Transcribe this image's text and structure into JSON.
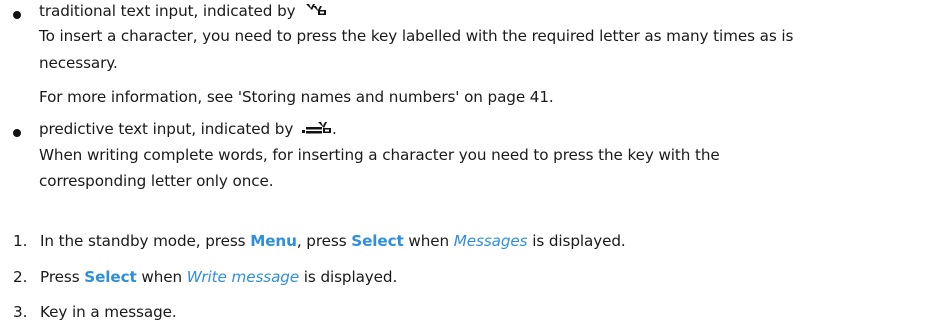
{
  "bullets": [
    {
      "lead": "traditional text input, indicated by",
      "icon": "traditional-input-icon",
      "lines": [
        "To insert a character, you need to press the key labelled with the required letter as many times as is",
        "necessary.",
        "For more information, see 'Storing names and numbers' on page 41."
      ]
    },
    {
      "lead": "predictive text input, indicated by",
      "icon": "predictive-input-icon",
      "lead_end": ".",
      "lines": [
        "When writing complete words, for inserting a character you need to press the key with the",
        "corresponding letter only once."
      ]
    }
  ],
  "steps": [
    {
      "num": "1.",
      "pre": "In the standby mode, press",
      "key1": "Menu",
      "mid": ", press",
      "key2": "Select",
      "mid2": "when",
      "italic": "Messages",
      "post": "is displayed."
    },
    {
      "num": "2.",
      "pre": "Press",
      "key1": "Select",
      "mid": "when",
      "italic": "Write message",
      "post": "is displayed."
    },
    {
      "num": "3.",
      "text": "Key in a message."
    }
  ],
  "colors": {
    "accent": "#2f8fdc",
    "text": "#1a1a1a"
  }
}
